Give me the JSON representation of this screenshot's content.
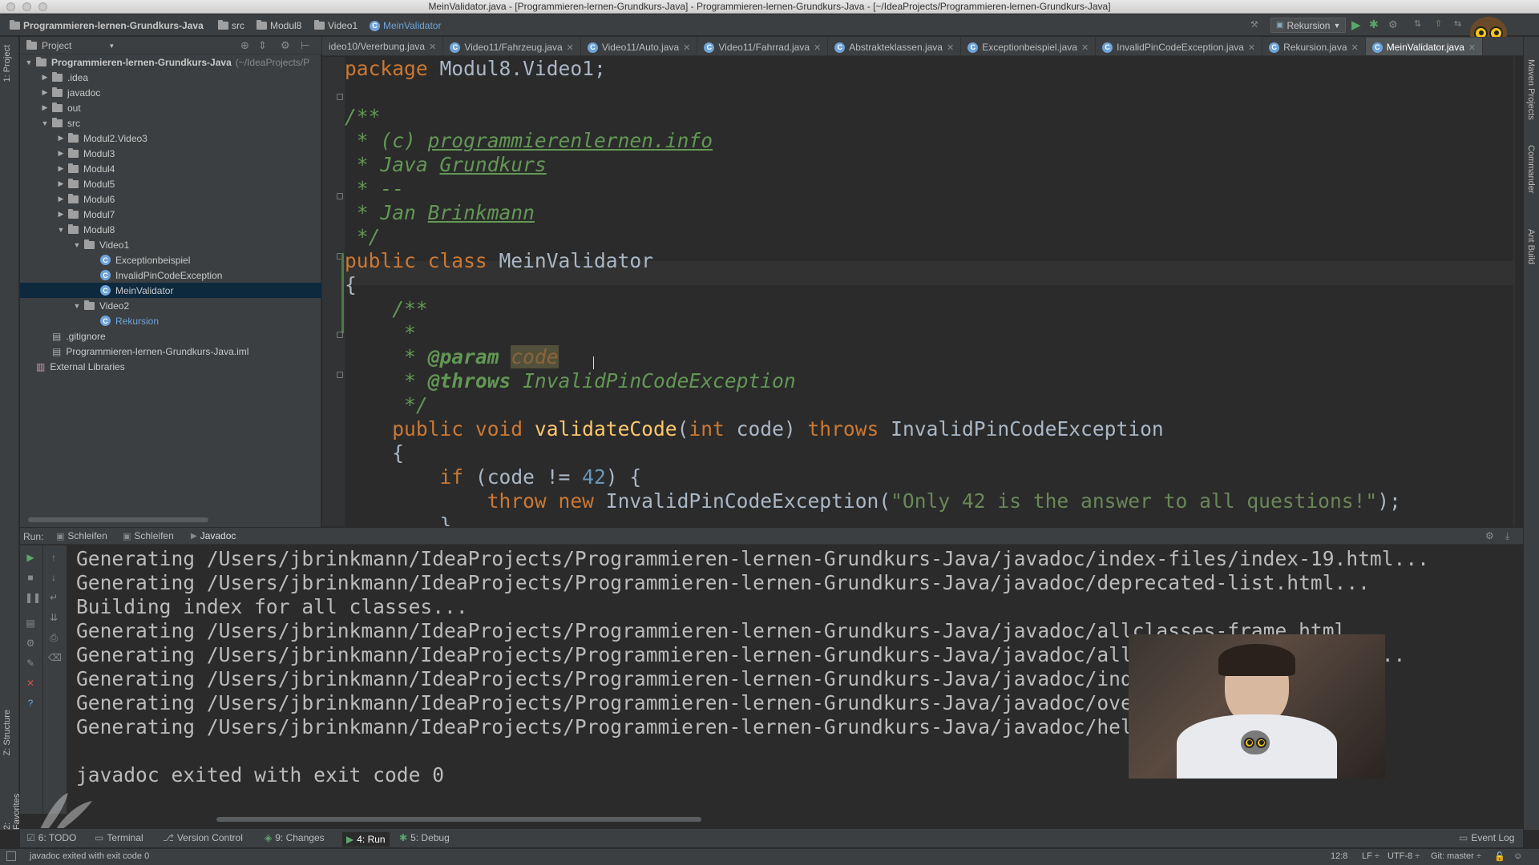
{
  "window": {
    "title": "MeinValidator.java - [Programmieren-lernen-Grundkurs-Java] - Programmieren-lernen-Grundkurs-Java - [~/IdeaProjects/Programmieren-lernen-Grundkurs-Java]"
  },
  "breadcrumbs": [
    "Programmieren-lernen-Grundkurs-Java",
    "src",
    "Modul8",
    "Video1",
    "MeinValidator"
  ],
  "run_config": "Rekursion",
  "left_strip": {
    "project": "1: Project",
    "structure": "Z: Structure",
    "favorites": "2: Favorites"
  },
  "right_strip": {
    "maven": "Maven Projects",
    "commander": "Commander",
    "ant": "Ant Build"
  },
  "project_panel": {
    "header": "Project",
    "tree": [
      {
        "label": "Programmieren-lernen-Grundkurs-Java",
        "suffix": "(~/IdeaProjects/P",
        "depth": 0,
        "type": "module",
        "arrow": "▼"
      },
      {
        "label": ".idea",
        "depth": 1,
        "type": "folder",
        "arrow": "▶"
      },
      {
        "label": "javadoc",
        "depth": 1,
        "type": "folder",
        "arrow": "▶"
      },
      {
        "label": "out",
        "depth": 1,
        "type": "folder",
        "arrow": "▶"
      },
      {
        "label": "src",
        "depth": 1,
        "type": "folder",
        "arrow": "▼"
      },
      {
        "label": "Modul2.Video3",
        "depth": 2,
        "type": "folder",
        "arrow": "▶"
      },
      {
        "label": "Modul3",
        "depth": 2,
        "type": "folder",
        "arrow": "▶"
      },
      {
        "label": "Modul4",
        "depth": 2,
        "type": "folder",
        "arrow": "▶"
      },
      {
        "label": "Modul5",
        "depth": 2,
        "type": "folder",
        "arrow": "▶"
      },
      {
        "label": "Modul6",
        "depth": 2,
        "type": "folder",
        "arrow": "▶"
      },
      {
        "label": "Modul7",
        "depth": 2,
        "type": "folder",
        "arrow": "▶"
      },
      {
        "label": "Modul8",
        "depth": 2,
        "type": "folder",
        "arrow": "▼"
      },
      {
        "label": "Video1",
        "depth": 3,
        "type": "folder",
        "arrow": "▼"
      },
      {
        "label": "Exceptionbeispiel",
        "depth": 4,
        "type": "class",
        "arrow": ""
      },
      {
        "label": "InvalidPinCodeException",
        "depth": 4,
        "type": "class",
        "arrow": ""
      },
      {
        "label": "MeinValidator",
        "depth": 4,
        "type": "class",
        "arrow": "",
        "selected": true
      },
      {
        "label": "Video2",
        "depth": 3,
        "type": "folder",
        "arrow": "▼"
      },
      {
        "label": "Rekursion",
        "depth": 4,
        "type": "class",
        "arrow": ""
      },
      {
        "label": ".gitignore",
        "depth": 1,
        "type": "file",
        "arrow": ""
      },
      {
        "label": "Programmieren-lernen-Grundkurs-Java.iml",
        "depth": 1,
        "type": "file",
        "arrow": ""
      },
      {
        "label": "External Libraries",
        "depth": 0,
        "type": "lib",
        "arrow": ""
      }
    ]
  },
  "editor_tabs": [
    {
      "label": "ideo10/Vererbung.java"
    },
    {
      "label": "Video11/Fahrzeug.java"
    },
    {
      "label": "Video11/Auto.java"
    },
    {
      "label": "Video11/Fahrrad.java"
    },
    {
      "label": "Abstrakteklassen.java"
    },
    {
      "label": "Exceptionbeispiel.java"
    },
    {
      "label": "InvalidPinCodeException.java"
    },
    {
      "label": "Rekursion.java"
    },
    {
      "label": "MeinValidator.java",
      "active": true
    }
  ],
  "code": {
    "l1_kw": "package",
    "l1_rest": " Modul8.Video1;",
    "l3": "/**",
    "l4_pre": " * (c) ",
    "l4_link": "programmierenlernen.info",
    "l5_pre": " * Java ",
    "l5_ul": "Grundkurs",
    "l6": " * --",
    "l7_pre": " * Jan ",
    "l7_ul": "Brinkmann",
    "l8": " */",
    "l9_kw": "public class",
    "l9_rest": " MeinValidator",
    "l10": "{",
    "l11": "    /**",
    "l12": "     *",
    "l13_pre": "     * ",
    "l13_tag": "@param",
    "l13_sp": " ",
    "l13_hl": "code",
    "l14_pre": "     * ",
    "l14_tag": "@throws",
    "l14_rest": " InvalidPinCodeException",
    "l15": "     */",
    "l16_ind": "    ",
    "l16_kw1": "public void",
    "l16_sp": " ",
    "l16_fn": "validateCode",
    "l16_p1": "(",
    "l16_kw2": "int",
    "l16_p2": " code) ",
    "l16_kw3": "throws",
    "l16_p3": " InvalidPinCodeException",
    "l17": "    {",
    "l18_ind": "        ",
    "l18_kw": "if",
    "l18_p1": " (code != ",
    "l18_num": "42",
    "l18_p2": ") {",
    "l19_ind": "            ",
    "l19_kw": "throw new",
    "l19_p1": " InvalidPinCodeException(",
    "l19_str": "\"Only 42 is the answer to all questions!\"",
    "l19_p2": ");",
    "l20": "        }"
  },
  "run_panel": {
    "label": "Run:",
    "tabs": [
      "Schleifen",
      "Schleifen",
      "Javadoc"
    ],
    "console": [
      "Generating /Users/jbrinkmann/IdeaProjects/Programmieren-lernen-Grundkurs-Java/javadoc/index-files/index-19.html...",
      "Generating /Users/jbrinkmann/IdeaProjects/Programmieren-lernen-Grundkurs-Java/javadoc/deprecated-list.html...",
      "Building index for all classes...",
      "Generating /Users/jbrinkmann/IdeaProjects/Programmieren-lernen-Grundkurs-Java/javadoc/allclasses-frame.html...",
      "Generating /Users/jbrinkmann/IdeaProjects/Programmieren-lernen-Grundkurs-Java/javadoc/allclasses-noframe.html...",
      "Generating /Users/jbrinkmann/IdeaProjects/Programmieren-lernen-Grundkurs-Java/javadoc/index.html...",
      "Generating /Users/jbrinkmann/IdeaProjects/Programmieren-lernen-Grundkurs-Java/javadoc/overview-summary.html...",
      "Generating /Users/jbrinkmann/IdeaProjects/Programmieren-lernen-Grundkurs-Java/javadoc/help-doc.html...",
      "",
      "javadoc exited with exit code 0"
    ]
  },
  "bottom_tools": [
    {
      "label": "6: TODO"
    },
    {
      "label": "Terminal"
    },
    {
      "label": "Version Control"
    },
    {
      "label": "9: Changes"
    },
    {
      "label": "4: Run",
      "active": true
    },
    {
      "label": "5: Debug"
    }
  ],
  "event_log": "Event Log",
  "status": {
    "message": "javadoc exited with exit code 0",
    "position": "12:8",
    "line_sep": "LF ÷",
    "encoding": "UTF-8 ÷",
    "vcs": "Git: master ÷"
  },
  "colors": {
    "keyword": "#cc7832",
    "comment": "#629755",
    "string": "#6a8759",
    "number": "#6897bb",
    "function": "#ffc66d",
    "selection": "#0d293e"
  }
}
